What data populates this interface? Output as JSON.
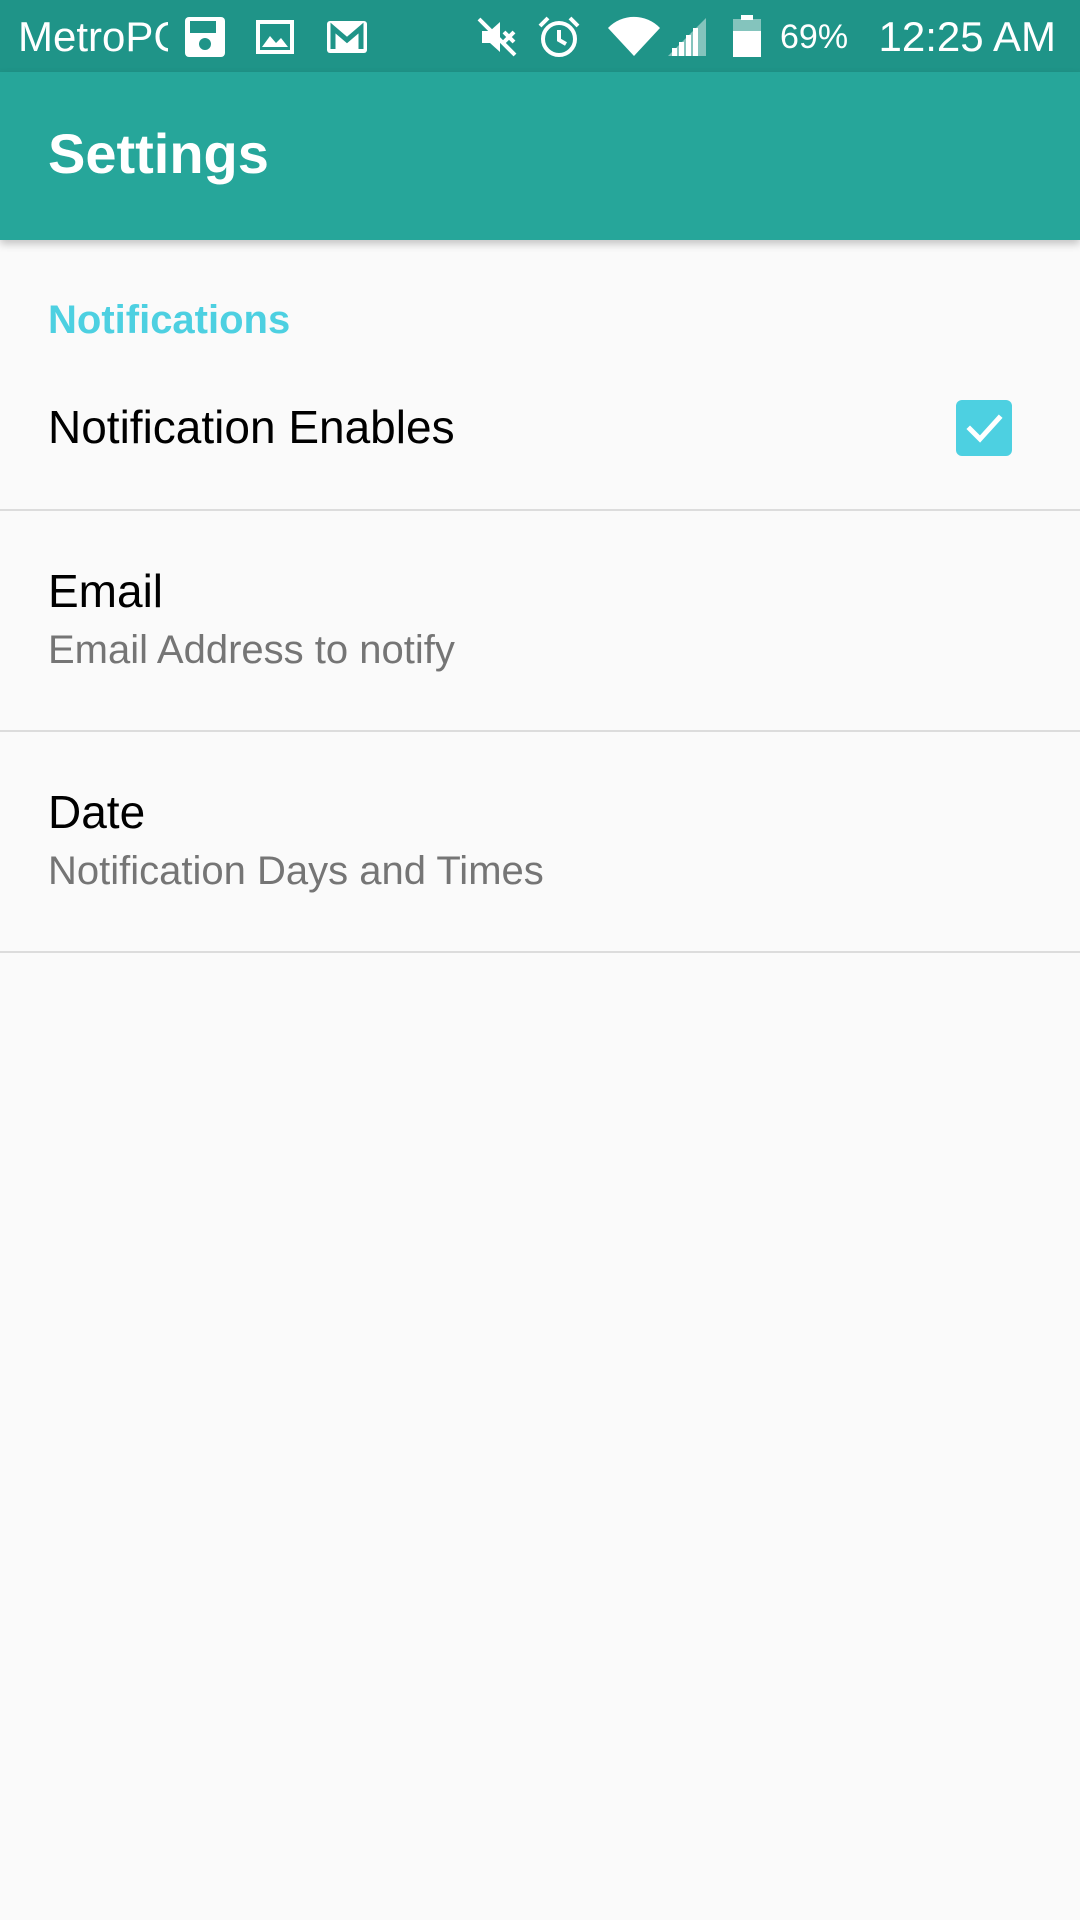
{
  "status_bar": {
    "carrier": "MetroPCS",
    "battery_percent": "69%",
    "time": "12:25 AM",
    "icons": [
      "save-icon",
      "image-icon",
      "gmail-icon",
      "mute-icon",
      "alarm-icon",
      "wifi-icon",
      "signal-icon",
      "battery-icon"
    ]
  },
  "app_bar": {
    "title": "Settings"
  },
  "settings": {
    "category": "Notifications",
    "items": [
      {
        "title": "Notification Enables",
        "checked": true
      },
      {
        "title": "Email",
        "summary": "Email Address to notify"
      },
      {
        "title": "Date",
        "summary": "Notification Days and Times"
      }
    ]
  },
  "colors": {
    "status_bar": "#1f9488",
    "app_bar": "#26a69a",
    "accent": "#4dd0e1",
    "background": "#fafafa"
  }
}
